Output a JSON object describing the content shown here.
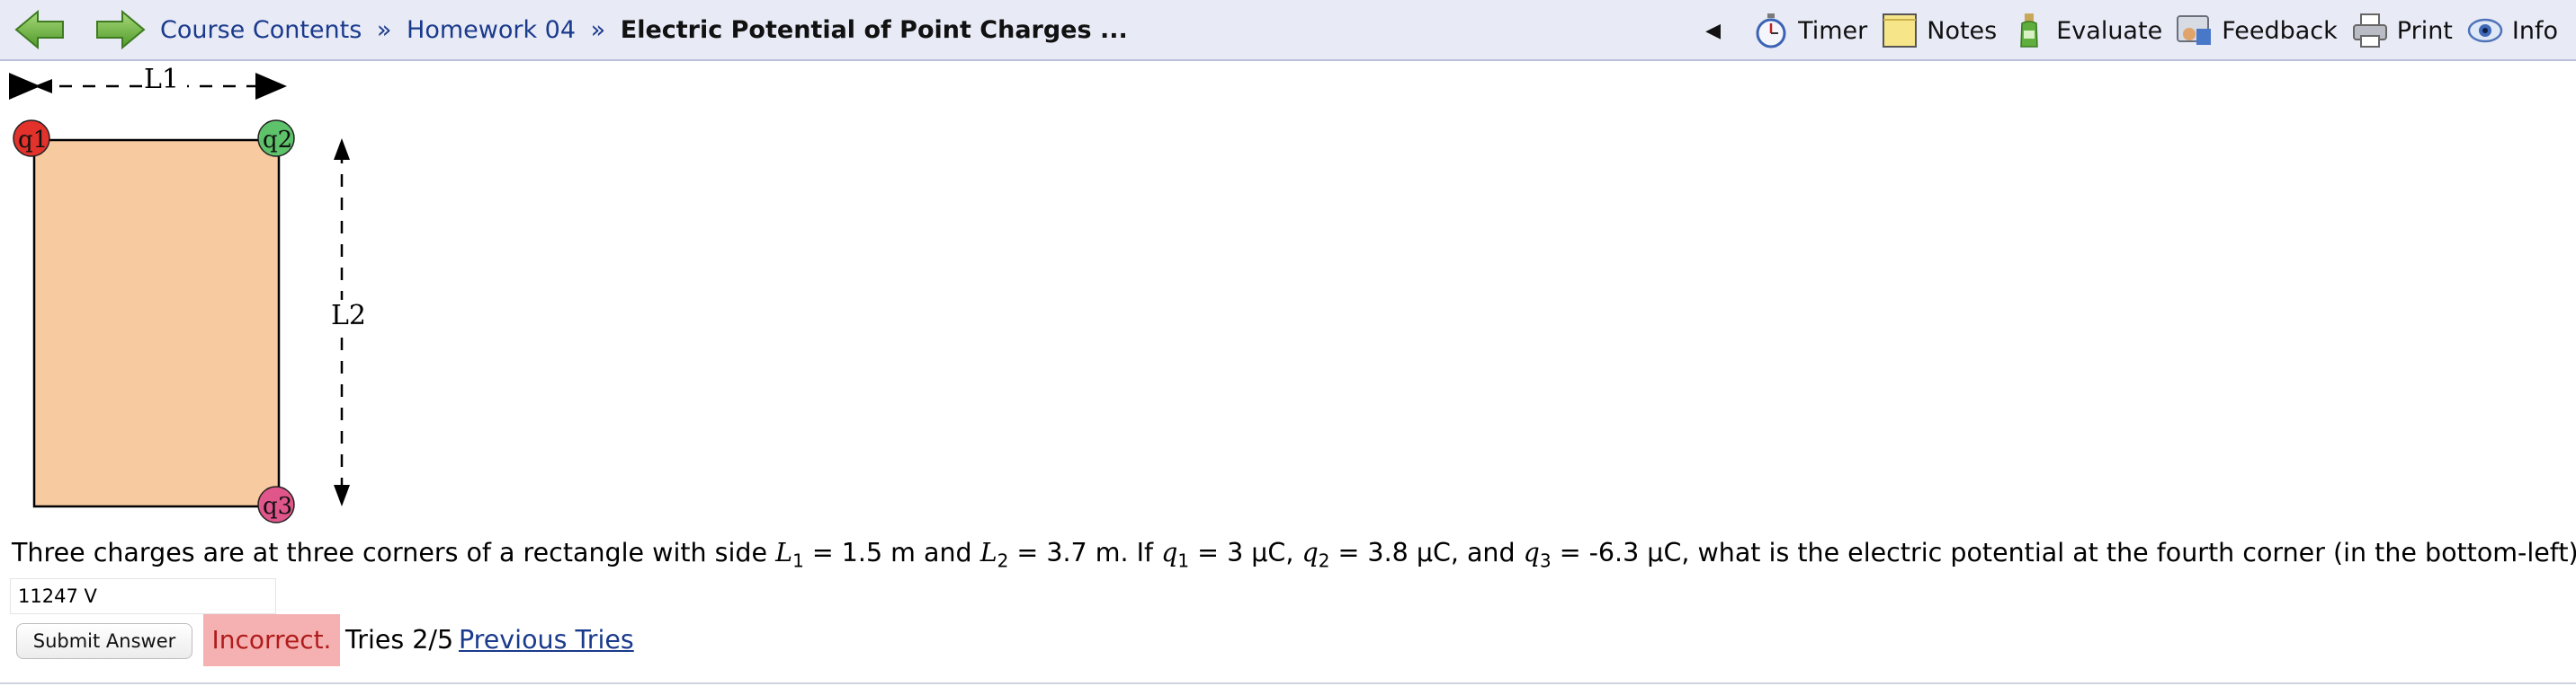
{
  "nav": {
    "back_icon": "back-arrow-icon",
    "forward_icon": "forward-arrow-icon",
    "breadcrumb": {
      "course_contents": "Course Contents",
      "sep1": "»",
      "homework": "Homework 04",
      "sep2": "»",
      "current": "Electric Potential of Point Charges ..."
    },
    "collapse_glyph": "◀",
    "tools": [
      {
        "label": "Timer",
        "icon": "stopwatch-icon"
      },
      {
        "label": "Notes",
        "icon": "notepad-icon"
      },
      {
        "label": "Evaluate",
        "icon": "bottle-icon"
      },
      {
        "label": "Feedback",
        "icon": "feedback-icon"
      },
      {
        "label": "Print",
        "icon": "printer-icon"
      },
      {
        "label": "Info",
        "icon": "eye-icon"
      }
    ]
  },
  "figure": {
    "l1_label": "L1",
    "l2_label": "L2",
    "charges": [
      {
        "label": "q1",
        "color": "#e3312c"
      },
      {
        "label": "q2",
        "color": "#5ec26a"
      },
      {
        "label": "q3",
        "color": "#e0568b"
      }
    ],
    "rect_fill": "#f7caa0"
  },
  "question": {
    "part1": "Three charges are at three corners of a rectangle with side ",
    "L1_var": "L",
    "L1_sub": "1",
    "L1_val": " = 1.5 m and ",
    "L2_var": "L",
    "L2_sub": "2",
    "L2_val": " = 3.7 m. If ",
    "q1_var": "q",
    "q1_sub": "1",
    "q1_val": " = 3 μC, ",
    "q2_var": "q",
    "q2_sub": "2",
    "q2_val": " = 3.8 μC, and ",
    "q3_var": "q",
    "q3_sub": "3",
    "q3_val": " = -6.3 μC, what is the electric potential at the fourth corner (in the bottom-left)?"
  },
  "answer": {
    "value": "11247 V"
  },
  "submit_label": "Submit Answer",
  "status": {
    "result": "Incorrect.",
    "tries": "Tries 2/5",
    "previous_tries": "Previous Tries",
    "result_bg": "#f5b1b1"
  }
}
